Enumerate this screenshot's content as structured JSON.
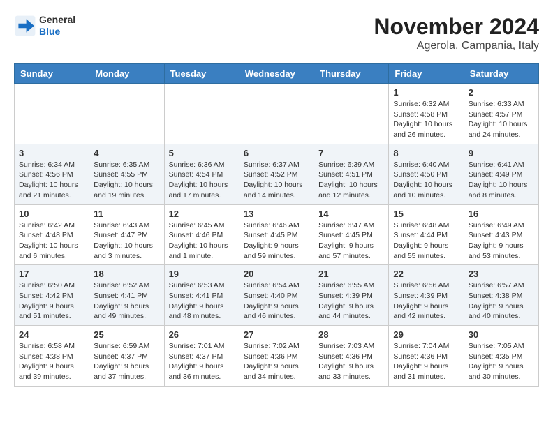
{
  "header": {
    "logo_general": "General",
    "logo_blue": "Blue",
    "month_title": "November 2024",
    "location": "Agerola, Campania, Italy"
  },
  "weekdays": [
    "Sunday",
    "Monday",
    "Tuesday",
    "Wednesday",
    "Thursday",
    "Friday",
    "Saturday"
  ],
  "weeks": [
    [
      {
        "day": "",
        "info": ""
      },
      {
        "day": "",
        "info": ""
      },
      {
        "day": "",
        "info": ""
      },
      {
        "day": "",
        "info": ""
      },
      {
        "day": "",
        "info": ""
      },
      {
        "day": "1",
        "info": "Sunrise: 6:32 AM\nSunset: 4:58 PM\nDaylight: 10 hours and 26 minutes."
      },
      {
        "day": "2",
        "info": "Sunrise: 6:33 AM\nSunset: 4:57 PM\nDaylight: 10 hours and 24 minutes."
      }
    ],
    [
      {
        "day": "3",
        "info": "Sunrise: 6:34 AM\nSunset: 4:56 PM\nDaylight: 10 hours and 21 minutes."
      },
      {
        "day": "4",
        "info": "Sunrise: 6:35 AM\nSunset: 4:55 PM\nDaylight: 10 hours and 19 minutes."
      },
      {
        "day": "5",
        "info": "Sunrise: 6:36 AM\nSunset: 4:54 PM\nDaylight: 10 hours and 17 minutes."
      },
      {
        "day": "6",
        "info": "Sunrise: 6:37 AM\nSunset: 4:52 PM\nDaylight: 10 hours and 14 minutes."
      },
      {
        "day": "7",
        "info": "Sunrise: 6:39 AM\nSunset: 4:51 PM\nDaylight: 10 hours and 12 minutes."
      },
      {
        "day": "8",
        "info": "Sunrise: 6:40 AM\nSunset: 4:50 PM\nDaylight: 10 hours and 10 minutes."
      },
      {
        "day": "9",
        "info": "Sunrise: 6:41 AM\nSunset: 4:49 PM\nDaylight: 10 hours and 8 minutes."
      }
    ],
    [
      {
        "day": "10",
        "info": "Sunrise: 6:42 AM\nSunset: 4:48 PM\nDaylight: 10 hours and 6 minutes."
      },
      {
        "day": "11",
        "info": "Sunrise: 6:43 AM\nSunset: 4:47 PM\nDaylight: 10 hours and 3 minutes."
      },
      {
        "day": "12",
        "info": "Sunrise: 6:45 AM\nSunset: 4:46 PM\nDaylight: 10 hours and 1 minute."
      },
      {
        "day": "13",
        "info": "Sunrise: 6:46 AM\nSunset: 4:45 PM\nDaylight: 9 hours and 59 minutes."
      },
      {
        "day": "14",
        "info": "Sunrise: 6:47 AM\nSunset: 4:45 PM\nDaylight: 9 hours and 57 minutes."
      },
      {
        "day": "15",
        "info": "Sunrise: 6:48 AM\nSunset: 4:44 PM\nDaylight: 9 hours and 55 minutes."
      },
      {
        "day": "16",
        "info": "Sunrise: 6:49 AM\nSunset: 4:43 PM\nDaylight: 9 hours and 53 minutes."
      }
    ],
    [
      {
        "day": "17",
        "info": "Sunrise: 6:50 AM\nSunset: 4:42 PM\nDaylight: 9 hours and 51 minutes."
      },
      {
        "day": "18",
        "info": "Sunrise: 6:52 AM\nSunset: 4:41 PM\nDaylight: 9 hours and 49 minutes."
      },
      {
        "day": "19",
        "info": "Sunrise: 6:53 AM\nSunset: 4:41 PM\nDaylight: 9 hours and 48 minutes."
      },
      {
        "day": "20",
        "info": "Sunrise: 6:54 AM\nSunset: 4:40 PM\nDaylight: 9 hours and 46 minutes."
      },
      {
        "day": "21",
        "info": "Sunrise: 6:55 AM\nSunset: 4:39 PM\nDaylight: 9 hours and 44 minutes."
      },
      {
        "day": "22",
        "info": "Sunrise: 6:56 AM\nSunset: 4:39 PM\nDaylight: 9 hours and 42 minutes."
      },
      {
        "day": "23",
        "info": "Sunrise: 6:57 AM\nSunset: 4:38 PM\nDaylight: 9 hours and 40 minutes."
      }
    ],
    [
      {
        "day": "24",
        "info": "Sunrise: 6:58 AM\nSunset: 4:38 PM\nDaylight: 9 hours and 39 minutes."
      },
      {
        "day": "25",
        "info": "Sunrise: 6:59 AM\nSunset: 4:37 PM\nDaylight: 9 hours and 37 minutes."
      },
      {
        "day": "26",
        "info": "Sunrise: 7:01 AM\nSunset: 4:37 PM\nDaylight: 9 hours and 36 minutes."
      },
      {
        "day": "27",
        "info": "Sunrise: 7:02 AM\nSunset: 4:36 PM\nDaylight: 9 hours and 34 minutes."
      },
      {
        "day": "28",
        "info": "Sunrise: 7:03 AM\nSunset: 4:36 PM\nDaylight: 9 hours and 33 minutes."
      },
      {
        "day": "29",
        "info": "Sunrise: 7:04 AM\nSunset: 4:36 PM\nDaylight: 9 hours and 31 minutes."
      },
      {
        "day": "30",
        "info": "Sunrise: 7:05 AM\nSunset: 4:35 PM\nDaylight: 9 hours and 30 minutes."
      }
    ]
  ]
}
